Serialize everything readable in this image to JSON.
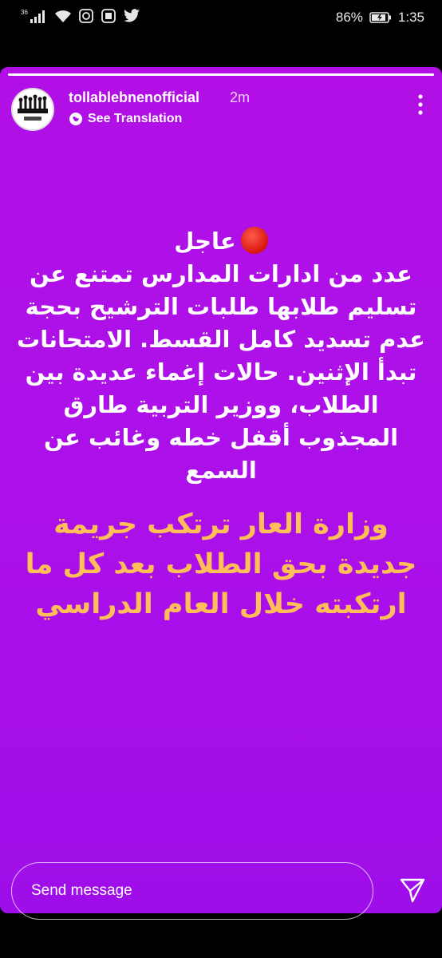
{
  "status_bar": {
    "network": "36",
    "battery_percent": "86%",
    "time": "1:35"
  },
  "story": {
    "progress": 1.0,
    "username": "tollablebnenofficial",
    "time_ago": "2m",
    "translation_label": "See Translation",
    "urgent_label": "عاجل",
    "main_text": "عدد من ادارات المدارس تمتنع عن تسليم طلابها طلبات الترشيح بحجة عدم تسديد كامل القسط. الامتحانات تبدأ الإثنين. حالات إغماء عديدة بين الطلاب، ووزير التربية طارق المجذوب أقفل خطه وغائب عن السمع",
    "secondary_text": "وزارة العار ترتكب جريمة جديدة بحق الطلاب بعد كل ما ارتكبته خلال العام الدراسي",
    "background_color": "#ad10e8",
    "accent_text_color": "#ffbe57"
  },
  "reply": {
    "placeholder": "Send message"
  },
  "icons": {
    "more": "more-vertical-icon",
    "globe": "globe-icon",
    "send": "send-icon",
    "signal": "signal-icon",
    "wifi": "wifi-icon",
    "battery": "battery-icon",
    "twitter": "twitter-icon",
    "notification": "notification-icon"
  }
}
